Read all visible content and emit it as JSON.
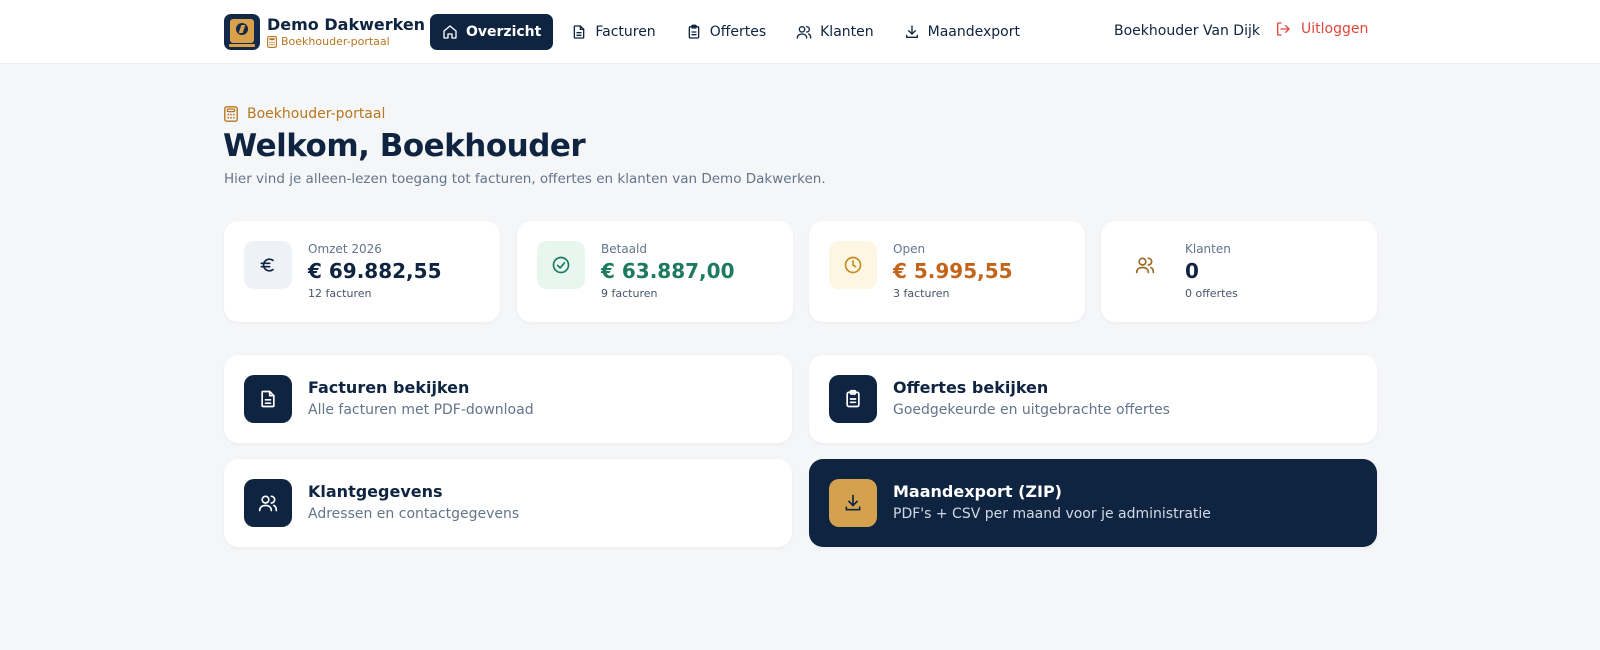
{
  "colors": {
    "navy": "#0f2440",
    "gold": "#b7761f",
    "green": "#1d7a5f",
    "orange": "#c2651a",
    "red": "#e0473a",
    "muted": "#64748b"
  },
  "header": {
    "brand_name": "Demo Dakwerken",
    "brand_sub": "Boekhouder-portaal",
    "nav": [
      {
        "label": "Overzicht",
        "icon": "home-icon",
        "active": true
      },
      {
        "label": "Facturen",
        "icon": "file-icon",
        "active": false
      },
      {
        "label": "Offertes",
        "icon": "clipboard-icon",
        "active": false
      },
      {
        "label": "Klanten",
        "icon": "users-icon",
        "active": false
      },
      {
        "label": "Maandexport",
        "icon": "download-icon",
        "active": false
      }
    ],
    "user": "Boekhouder Van Dijk",
    "logout": "Uitloggen"
  },
  "hero": {
    "eyebrow": "Boekhouder-portaal",
    "title": "Welkom, Boekhouder",
    "subtitle": "Hier vind je alleen-lezen toegang tot facturen, offertes en klanten van Demo Dakwerken."
  },
  "stats": [
    {
      "label": "Omzet 2026",
      "value": "€ 69.882,55",
      "sub": "12 facturen",
      "icon": "euro-icon"
    },
    {
      "label": "Betaald",
      "value": "€ 63.887,00",
      "sub": "9 facturen",
      "icon": "check-circle-icon"
    },
    {
      "label": "Open",
      "value": "€ 5.995,55",
      "sub": "3 facturen",
      "icon": "clock-icon"
    },
    {
      "label": "Klanten",
      "value": "0",
      "sub": "0 offertes",
      "icon": "users-icon"
    }
  ],
  "actions": [
    {
      "title": "Facturen bekijken",
      "desc": "Alle facturen met PDF-download",
      "icon": "file-icon"
    },
    {
      "title": "Offertes bekijken",
      "desc": "Goedgekeurde en uitgebrachte offertes",
      "icon": "clipboard-icon"
    },
    {
      "title": "Klantgegevens",
      "desc": "Adressen en contactgegevens",
      "icon": "users-icon"
    },
    {
      "title": "Maandexport (ZIP)",
      "desc": "PDF's + CSV per maand voor je administratie",
      "icon": "download-icon"
    }
  ]
}
